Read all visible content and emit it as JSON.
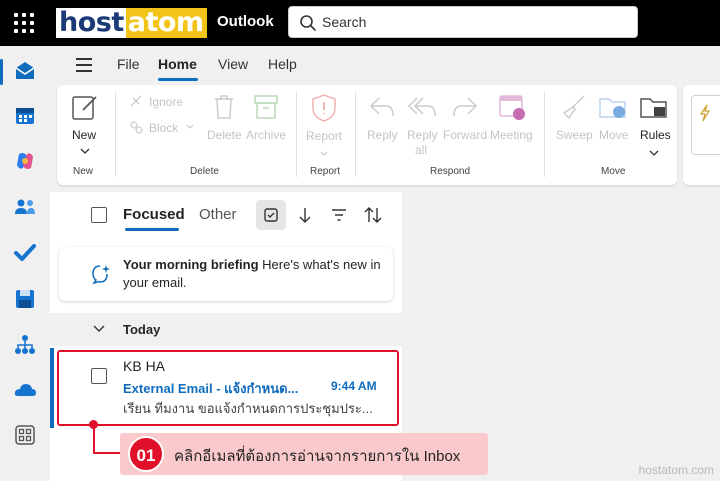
{
  "brand": {
    "logo_part1": "host",
    "logo_part2": "atom",
    "app_name": "Outlook"
  },
  "search": {
    "placeholder": "Search"
  },
  "menu_tabs": [
    "File",
    "Home",
    "View",
    "Help"
  ],
  "ribbon": {
    "new": {
      "label": "New",
      "group": "New"
    },
    "delete_group": {
      "ignore": "Ignore",
      "block": "Block",
      "delete": "Delete",
      "archive": "Archive",
      "group": "Delete"
    },
    "report": {
      "label": "Report",
      "group": "Report"
    },
    "respond": {
      "reply": "Reply",
      "reply_all_1": "Reply",
      "reply_all_2": "all",
      "forward": "Forward",
      "meeting": "Meeting",
      "group": "Respond"
    },
    "move_group": {
      "sweep": "Sweep",
      "move": "Move",
      "rules": "Rules",
      "group": "Move"
    }
  },
  "list": {
    "focused_tab": "Focused",
    "other_tab": "Other",
    "briefing_title": "Your morning briefing",
    "briefing_text": "Here's what's new in your email.",
    "section": "Today",
    "mail": {
      "sender": "KB HA",
      "subject": "External Email - แจ้งกำหนด...",
      "time": "9:44 AM",
      "preview": "เรียน ทีมงาน ขอแจ้งกำหนดการประชุมประ..."
    }
  },
  "annotation": {
    "step": "01",
    "text": "คลิกอีเมลที่ต้องการอ่านจากรายการใน Inbox"
  },
  "watermark": "hostatom.com",
  "colors": {
    "accent": "#0f6cbd",
    "annotation_red": "#e0102b",
    "annotation_bg": "#f9c9cc"
  }
}
